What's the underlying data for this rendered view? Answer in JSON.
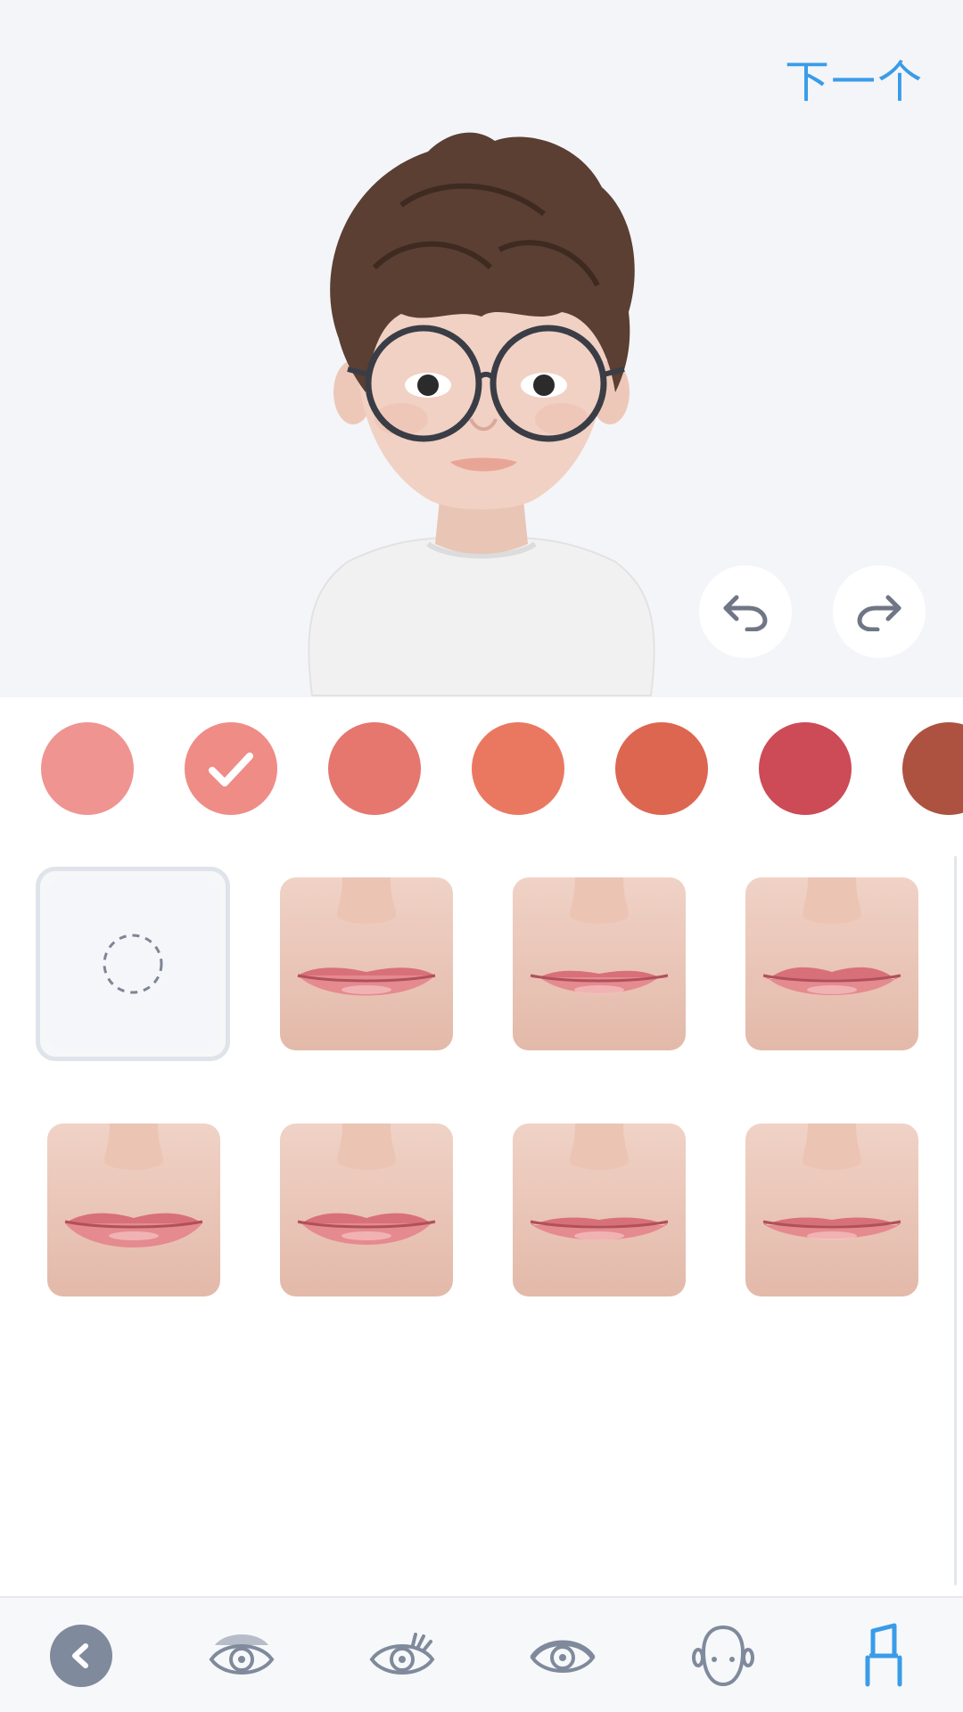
{
  "header": {
    "next_label": "下一个"
  },
  "controls": {
    "undo_icon": "undo-icon",
    "redo_icon": "redo-icon"
  },
  "lip_colors": {
    "swatches": [
      "#ef9491",
      "#ef8c86",
      "#e5776e",
      "#ea7861",
      "#dd6651",
      "#cc4b56",
      "#ad5240"
    ],
    "selected_index": 1
  },
  "lip_styles": {
    "items": [
      "none",
      "lips-1",
      "lips-2",
      "lips-3",
      "lips-4",
      "lips-5",
      "lips-6",
      "lips-7"
    ],
    "selected_index": 0
  },
  "bottom_nav": {
    "items": [
      "back-icon",
      "eye-shadow-icon",
      "eyelash-icon",
      "eye-icon",
      "face-icon",
      "lipstick-icon"
    ],
    "active_index": 5,
    "active_color": "#3a9ce8",
    "inactive_color": "#7f8a9c"
  }
}
